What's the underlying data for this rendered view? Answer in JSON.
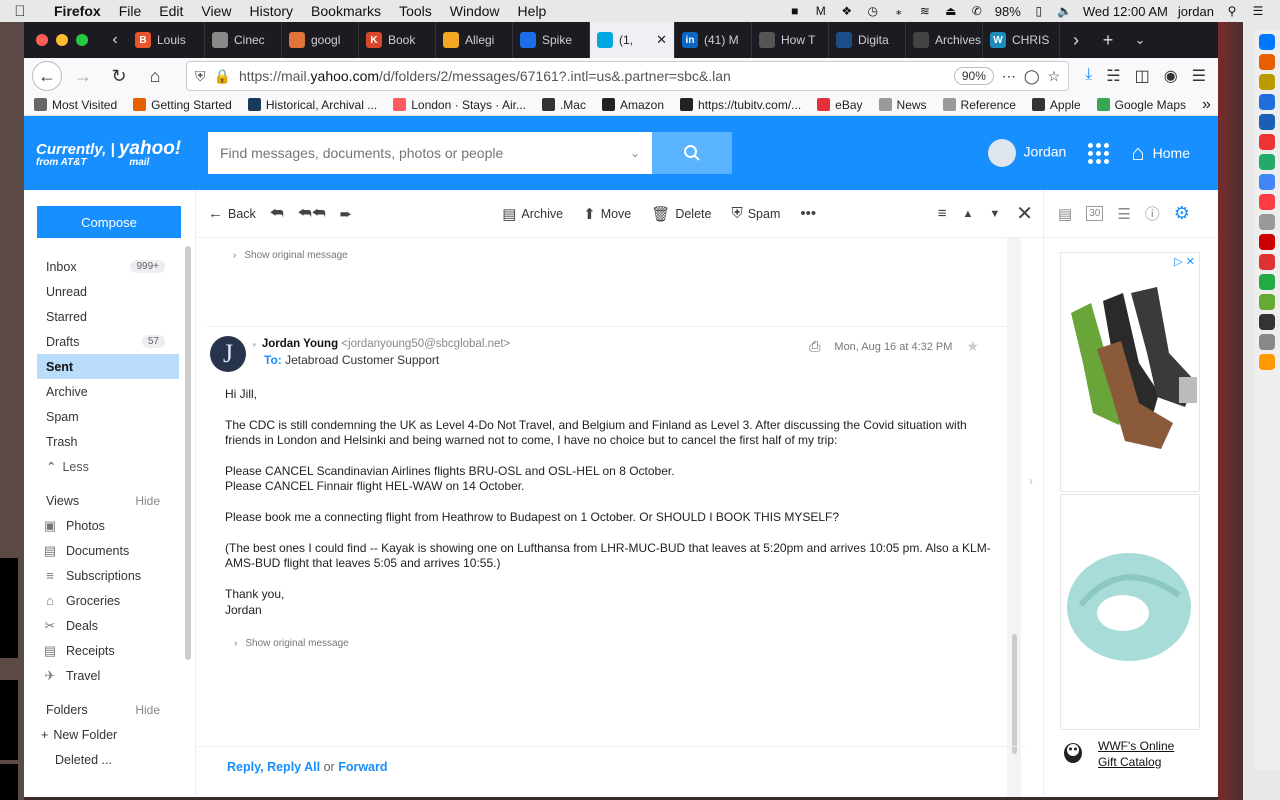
{
  "menubar": {
    "app": "Firefox",
    "items": [
      "File",
      "Edit",
      "View",
      "History",
      "Bookmarks",
      "Tools",
      "Window",
      "Help"
    ],
    "battery": "98%",
    "clock": "Wed 12:00 AM",
    "user": "jordan"
  },
  "tabs": [
    {
      "label": "Louis",
      "color": "#e8542c",
      "glyph": "B"
    },
    {
      "label": "Cinec",
      "color": "#888888",
      "glyph": ""
    },
    {
      "label": "googl",
      "color": "#e2733a",
      "glyph": ""
    },
    {
      "label": "Book",
      "color": "#d9472b",
      "glyph": "K"
    },
    {
      "label": "Allegi",
      "color": "#f5a623",
      "glyph": ""
    },
    {
      "label": "Spike",
      "color": "#1a6fe8",
      "glyph": ""
    },
    {
      "label": "(1,",
      "color": "#00a8e0",
      "glyph": "",
      "active": true
    },
    {
      "label": "(41) M",
      "color": "#0a66c2",
      "glyph": "in"
    },
    {
      "label": "How T",
      "color": "#555555",
      "glyph": ""
    },
    {
      "label": "Digita",
      "color": "#1a4f8b",
      "glyph": ""
    },
    {
      "label": "Archives |",
      "color": "#444444",
      "glyph": ""
    },
    {
      "label": "CHRIS",
      "color": "#1e8cbe",
      "glyph": "W"
    }
  ],
  "browser": {
    "url_prefix": "https://mail.",
    "url_domain": "yahoo.com",
    "url_rest": "/d/folders/2/messages/67161?.intl=us&.partner=sbc&.lan",
    "zoom": "90%"
  },
  "bookmarks": [
    {
      "label": "Most Visited",
      "icon": "gear-icon",
      "color": "#666666"
    },
    {
      "label": "Getting Started",
      "icon": "firefox-icon",
      "color": "#e66000"
    },
    {
      "label": "Historical, Archival ...",
      "icon": "v-logo-icon",
      "color": "#1a3a5a"
    },
    {
      "label": "London · Stays · Air...",
      "icon": "airbnb-icon",
      "color": "#ff5a5f"
    },
    {
      "label": ".Mac",
      "icon": "apple-icon",
      "color": "#333333"
    },
    {
      "label": "Amazon",
      "icon": "amazon-icon",
      "color": "#222222"
    },
    {
      "label": "https://tubitv.com/...",
      "icon": "tumblr-icon",
      "color": "#222222"
    },
    {
      "label": "eBay",
      "icon": "ebay-icon",
      "color": "#e53238"
    },
    {
      "label": "News",
      "icon": "folder-icon",
      "color": "#999999"
    },
    {
      "label": "Reference",
      "icon": "folder-icon",
      "color": "#999999"
    },
    {
      "label": "Apple",
      "icon": "apple-icon",
      "color": "#333333"
    },
    {
      "label": "Google Maps",
      "icon": "maps-icon",
      "color": "#34a853"
    }
  ],
  "yahoo": {
    "logo_line1": "Currently,",
    "logo_yahoo": "yahoo!",
    "logo_mail": "mail",
    "logo_line2": "from AT&T",
    "search_placeholder": "Find messages, documents, photos or people",
    "user": "Jordan",
    "home": "Home"
  },
  "nav": {
    "compose": "Compose",
    "folders": [
      {
        "label": "Inbox",
        "count": "999+"
      },
      {
        "label": "Unread",
        "count": ""
      },
      {
        "label": "Starred",
        "count": ""
      },
      {
        "label": "Drafts",
        "count": "57"
      },
      {
        "label": "Sent",
        "count": "",
        "selected": true
      },
      {
        "label": "Archive",
        "count": ""
      },
      {
        "label": "Spam",
        "count": ""
      },
      {
        "label": "Trash",
        "count": ""
      }
    ],
    "less": "Less",
    "views_title": "Views",
    "views_hide": "Hide",
    "views": [
      {
        "label": "Photos",
        "icon": "photo-icon"
      },
      {
        "label": "Documents",
        "icon": "document-icon"
      },
      {
        "label": "Subscriptions",
        "icon": "subscriptions-icon"
      },
      {
        "label": "Groceries",
        "icon": "basket-icon"
      },
      {
        "label": "Deals",
        "icon": "scissors-icon"
      },
      {
        "label": "Receipts",
        "icon": "receipt-icon"
      },
      {
        "label": "Travel",
        "icon": "plane-icon"
      }
    ],
    "folders_title": "Folders",
    "folders_hide": "Hide",
    "new_folder": "New Folder",
    "deleted": "Deleted ..."
  },
  "toolbar": {
    "back": "Back",
    "archive": "Archive",
    "move": "Move",
    "delete": "Delete",
    "spam": "Spam"
  },
  "message": {
    "show_original": "Show original message",
    "from_name": "Jordan Young",
    "from_email": "<jordanyoung50@sbcglobal.net>",
    "to_label": "To:",
    "to": "Jetabroad Customer Support",
    "date": "Mon, Aug 16 at 4:32 PM",
    "avatar_letter": "J",
    "greeting": "Hi Jill,",
    "p1": "The CDC is still condemning the UK as Level 4-Do Not Travel, and Belgium and Finland as Level 3. After discussing the Covid situation with friends in London and Helsinki and being warned not to come, I have no choice but to cancel the first half of my trip:",
    "p2a": "Please CANCEL Scandinavian Airlines flights BRU-OSL and OSL-HEL on 8 October.",
    "p2b": "Please CANCEL Finnair flight HEL-WAW on 14 October.",
    "p3": "Please book me a connecting flight from Heathrow to Budapest on 1 October. Or SHOULD I BOOK THIS MYSELF?",
    "p4": "(The best ones I could find -- Kayak is showing one on Lufthansa from LHR-MUC-BUD that leaves at 5:20pm and arrives 10:05 pm. Also a KLM-AMS-BUD flight that leaves 5:05 and arrives 10:55.)",
    "closing": "Thank you,",
    "signature": "Jordan"
  },
  "reply": {
    "reply": "Reply",
    "reply_all": "Reply All",
    "or": "or",
    "forward": "Forward"
  },
  "ad": {
    "text_line1": "WWF's Online",
    "text_line2": "Gift Catalog"
  }
}
